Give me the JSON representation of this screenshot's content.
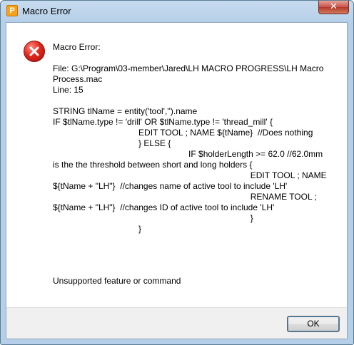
{
  "window": {
    "title": "Macro Error",
    "app_icon_letter": "P"
  },
  "dialog": {
    "heading": "Macro Error:",
    "file_line": "File: G:\\Program\\03-member\\Jared\\LH MACRO PROGRESS\\LH Macro Process.mac",
    "line_number": "Line: 15",
    "code": "STRING tlName = entity('tool','').name\nIF $tlName.type != 'drill' OR $tlName.type != 'thread_mill' {\n                                    EDIT TOOL ; NAME ${tName}  //Does nothing\n                                    } ELSE {\n                                                         IF $holderLength >= 62.0 //62.0mm is the the threshold between short and long holders {\n                                                                                   EDIT TOOL ; NAME ${tName + \"LH\"}  //changes name of active tool to include 'LH'\n                                                                                   RENAME TOOL ; ${tName + \"LH\"}  //changes ID of active tool to include 'LH'\n                                                                                   }\n                                    }",
    "footer_message": "Unsupported feature or command",
    "ok_label": "OK",
    "close_symbol": "✕"
  },
  "colors": {
    "error_red": "#e0271c",
    "title_bar": "#b6cfe8"
  },
  "icons": {
    "error": "error-x-circle-icon",
    "app": "powermill-app-icon",
    "close": "close-icon"
  }
}
